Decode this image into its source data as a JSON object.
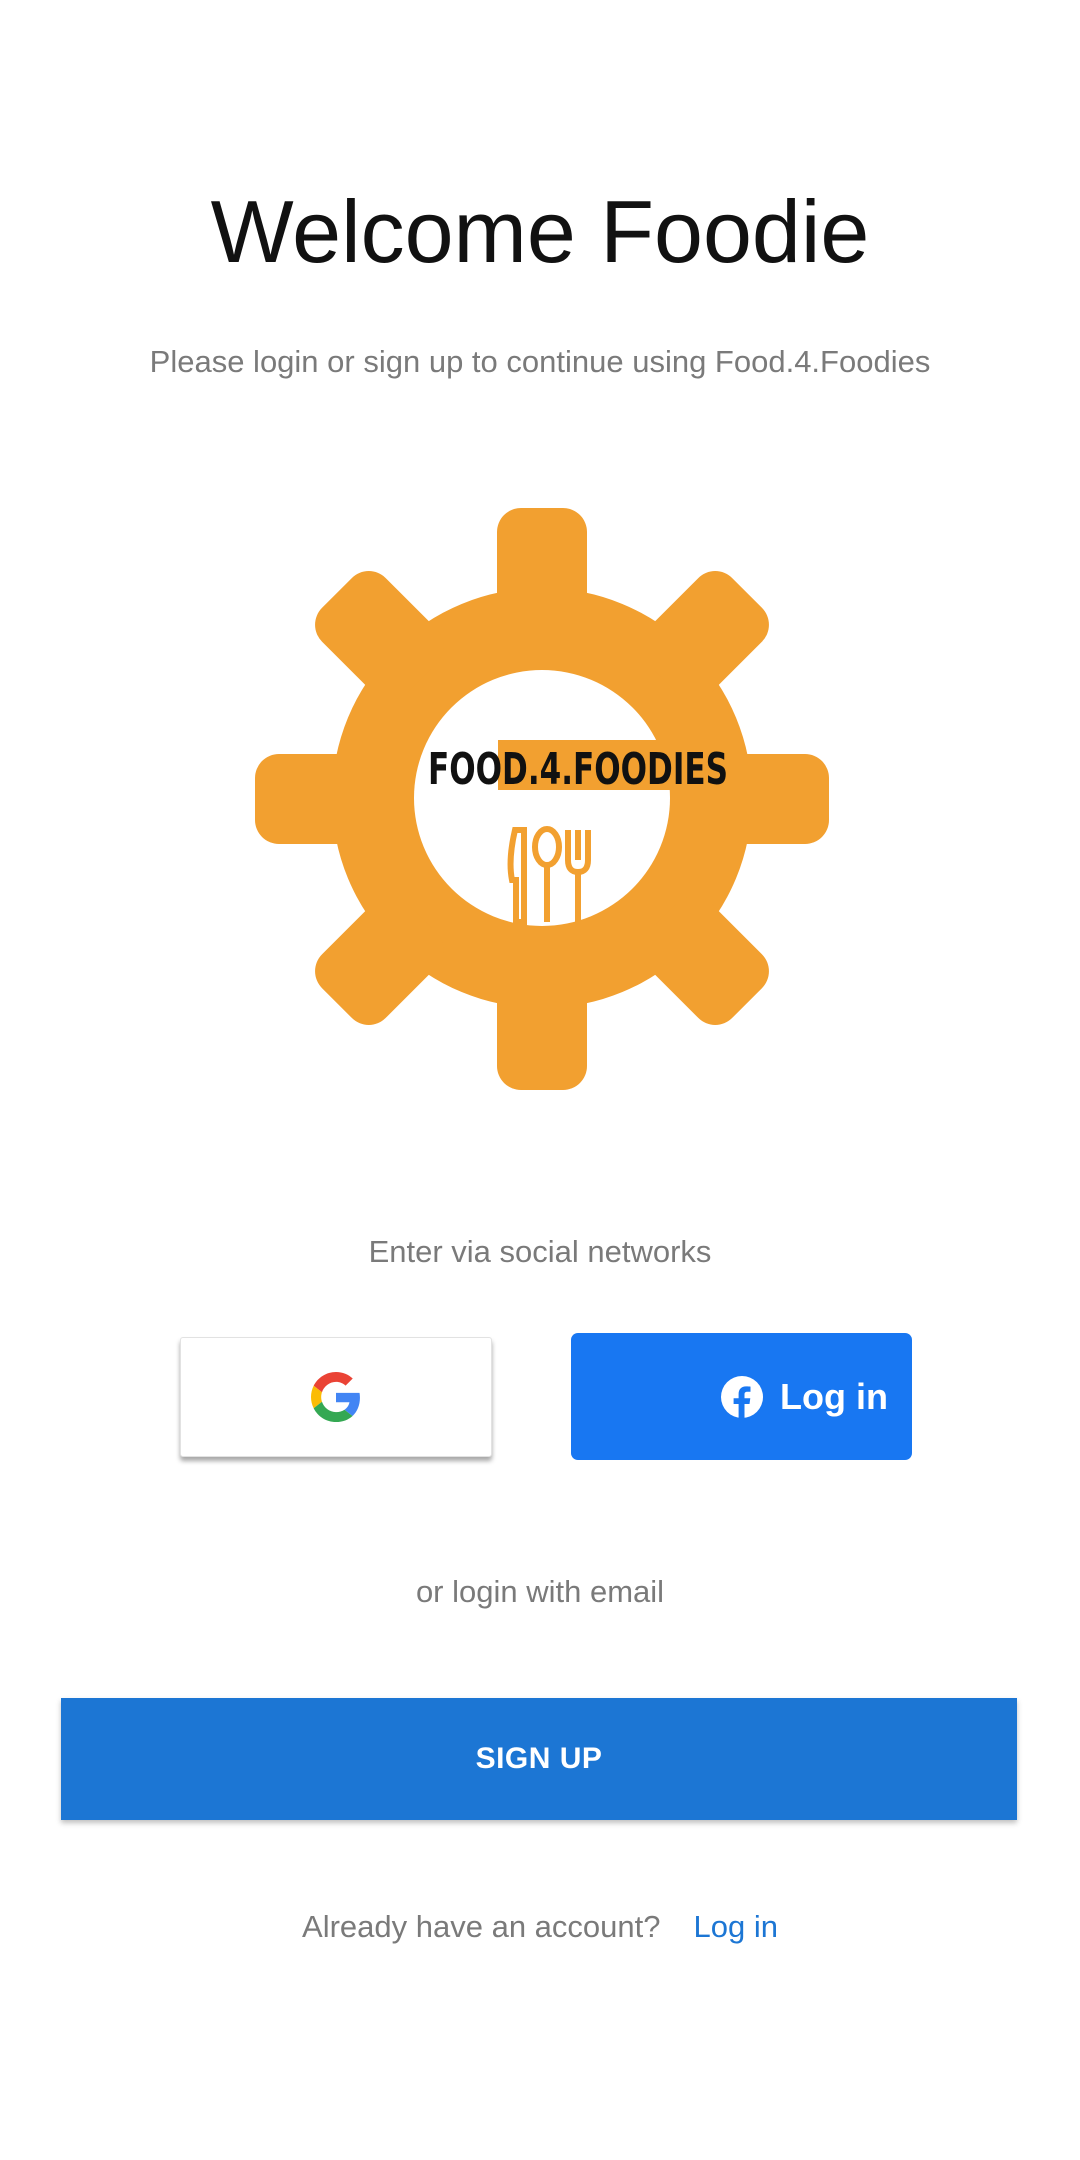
{
  "header": {
    "title": "Welcome Foodie",
    "subtitle": "Please login or sign up to continue using Food.4.Foodies"
  },
  "logo": {
    "text": "FOOD.4.FOODIES",
    "color": "#f2a030",
    "icon": "gear-with-cutlery"
  },
  "social": {
    "label": "Enter via social networks",
    "google_icon": "google-g-icon",
    "facebook_label": "Log in",
    "facebook_icon": "facebook-icon",
    "facebook_color": "#1877f2"
  },
  "email": {
    "label": "or login with email"
  },
  "signup": {
    "label": "SIGN UP",
    "color": "#1c76d4"
  },
  "account": {
    "prompt": "Already have an account?",
    "login_link": "Log in"
  }
}
